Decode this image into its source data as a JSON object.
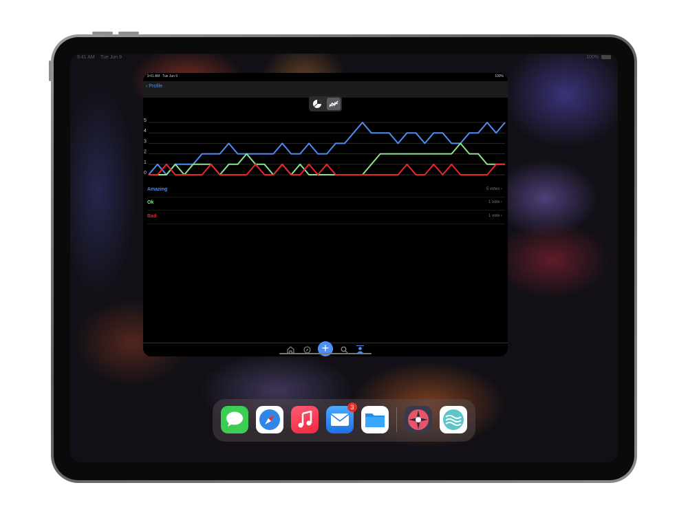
{
  "device_status": {
    "time": "9:41 AM",
    "date": "Tue Jun 9",
    "battery": "100%"
  },
  "app": {
    "status": {
      "time": "9:41 AM",
      "date": "Tue Jun 9",
      "battery": "100%"
    },
    "nav": {
      "back_label": "Profile"
    },
    "segments": [
      {
        "icon": "pie-chart-icon",
        "selected": false
      },
      {
        "icon": "line-chart-icon",
        "selected": true
      }
    ],
    "results": [
      {
        "label": "Amazing",
        "count": "5 votes",
        "color": "#4f8ef5"
      },
      {
        "label": "Ok",
        "count": "1 vote",
        "color": "#8fe38f"
      },
      {
        "label": "Bad",
        "count": "1 vote",
        "color": "#e8262c"
      }
    ],
    "tabs": [
      "home-icon",
      "compass-icon",
      "add-icon",
      "search-icon",
      "profile-icon"
    ],
    "plus_label": "+"
  },
  "chart_data": {
    "type": "line",
    "ylim": [
      0,
      5
    ],
    "yticks": [
      "0",
      "1",
      "2",
      "3",
      "4",
      "5"
    ],
    "grid": true,
    "x": [
      0,
      1,
      2,
      3,
      4,
      5,
      6,
      7,
      8,
      9,
      10,
      11,
      12,
      13,
      14,
      15,
      16,
      17,
      18,
      19,
      20,
      21,
      22,
      23,
      24,
      25,
      26,
      27,
      28,
      29,
      30,
      31,
      32,
      33,
      34,
      35,
      36,
      37,
      38,
      39,
      40
    ],
    "series": [
      {
        "name": "Amazing",
        "color": "#4f8ef5",
        "values": [
          0,
          1,
          0,
          1,
          1,
          1,
          2,
          2,
          2,
          3,
          2,
          2,
          2,
          2,
          2,
          3,
          2,
          2,
          3,
          2,
          2,
          3,
          3,
          4,
          5,
          4,
          4,
          4,
          3,
          4,
          4,
          3,
          4,
          4,
          3,
          3,
          4,
          4,
          5,
          4,
          5
        ]
      },
      {
        "name": "Ok",
        "color": "#8fe38f",
        "values": [
          0,
          0,
          0,
          1,
          0,
          1,
          1,
          1,
          0,
          1,
          1,
          2,
          1,
          1,
          0,
          1,
          0,
          1,
          0,
          0,
          0,
          0,
          0,
          0,
          0,
          1,
          2,
          2,
          2,
          2,
          2,
          2,
          2,
          2,
          2,
          3,
          2,
          2,
          1,
          1,
          1
        ]
      },
      {
        "name": "Bad",
        "color": "#e8262c",
        "values": [
          0,
          0,
          1,
          0,
          0,
          0,
          0,
          1,
          0,
          0,
          0,
          0,
          1,
          0,
          0,
          1,
          0,
          0,
          1,
          0,
          1,
          0,
          0,
          0,
          0,
          0,
          0,
          0,
          0,
          1,
          0,
          0,
          1,
          0,
          1,
          0,
          0,
          0,
          0,
          1,
          1
        ]
      }
    ]
  },
  "dock": {
    "apps": [
      {
        "name": "messages-app-icon"
      },
      {
        "name": "safari-app-icon"
      },
      {
        "name": "music-app-icon"
      },
      {
        "name": "mail-app-icon",
        "badge": "3"
      },
      {
        "name": "files-app-icon"
      },
      {
        "name": "compass-app-icon"
      },
      {
        "name": "waves-app-icon"
      }
    ]
  }
}
